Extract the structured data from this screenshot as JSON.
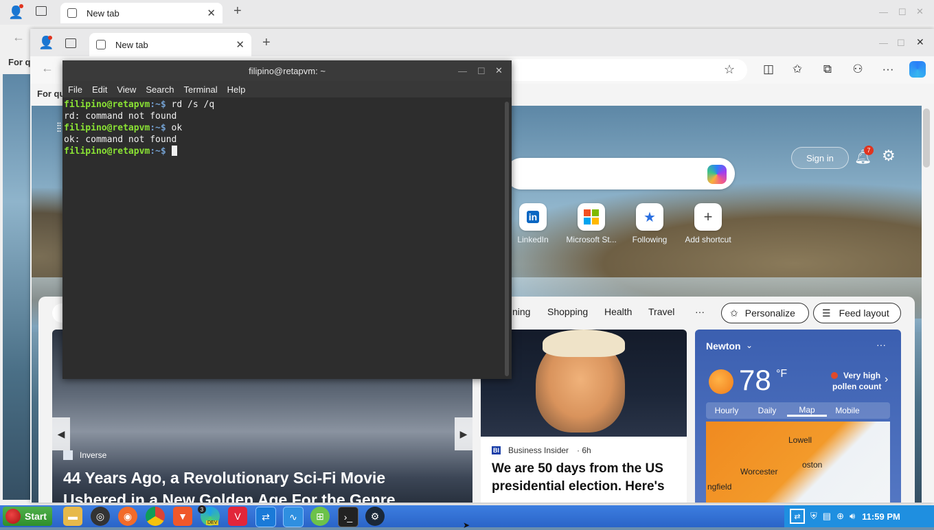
{
  "back_window": {
    "tab_title": "New tab",
    "for_quick_text": "For q"
  },
  "front_window": {
    "tab_title": "New tab",
    "for_quick_text": "For qu",
    "page": {
      "sign_in": "Sign in",
      "notifications_count": "7",
      "shortcuts": [
        {
          "label": "LinkedIn",
          "icon": "linkedin-icon"
        },
        {
          "label": "Microsoft St...",
          "icon": "microsoft-store-icon"
        },
        {
          "label": "Following",
          "icon": "following-icon"
        },
        {
          "label": "Add shortcut",
          "icon": "plus-icon"
        }
      ],
      "feed_nav": [
        "ning",
        "Shopping",
        "Health",
        "Travel",
        "···"
      ],
      "personalize_label": "Personalize",
      "feed_layout_label": "Feed layout",
      "hero": {
        "source": "Inverse",
        "headline_line1": "44 Years Ago, a Revolutionary Sci-Fi Movie",
        "headline_line2": "Ushered in a New Golden Age For the Genre"
      },
      "news": {
        "source_badge": "BI",
        "source": "Business Insider",
        "age": "· 6h",
        "headline": "We are 50 days from the US presidential election. Here's"
      },
      "weather": {
        "location": "Newton",
        "temperature": "78",
        "unit": "°F",
        "alert_line1": "Very high",
        "alert_line2": "pollen count",
        "tabs": [
          "Hourly",
          "Daily",
          "Map",
          "Mobile"
        ],
        "map_labels": [
          "Lowell",
          "Worcester",
          "oston",
          "ngfield"
        ]
      }
    }
  },
  "terminal": {
    "title": "filipino@retapvm: ~",
    "menu": [
      "File",
      "Edit",
      "View",
      "Search",
      "Terminal",
      "Help"
    ],
    "lines": [
      {
        "prompt": "filipino@retapvm",
        "path": ":~$ ",
        "cmd": "rd /s /q"
      },
      {
        "output": "rd: command not found"
      },
      {
        "prompt": "filipino@retapvm",
        "path": ":~$ ",
        "cmd": "ok"
      },
      {
        "output": "ok: command not found"
      },
      {
        "prompt": "filipino@retapvm",
        "path": ":~$ ",
        "cmd": ""
      }
    ]
  },
  "taskbar": {
    "start_label": "Start",
    "edge_dev_badge": "3",
    "edge_dev_label": "DEV",
    "clock": "11:59 PM"
  },
  "colors": {
    "terminal_prompt": "#8ae234",
    "terminal_path": "#729fcf",
    "taskbar": "#2a64c8",
    "start_button": "#2f8f2c",
    "weather_card": "#3b5fb0"
  }
}
